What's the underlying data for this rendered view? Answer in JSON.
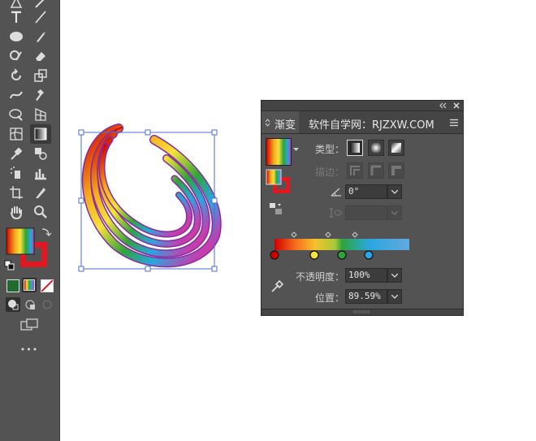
{
  "panel": {
    "tab_title": "渐变",
    "tab_watermark": "软件自学网：RJZXW.COM",
    "type_label": "类型：",
    "stroke_label": "描边：",
    "angle_value": "0°",
    "opacity_label": "不透明度：",
    "opacity_value": "100%",
    "location_label": "位置：",
    "location_value": "89.59%",
    "gradient_stops": [
      "#d10000",
      "#f5e33a",
      "#2fa43b",
      "#2aa6e0"
    ],
    "gradient_end_color": "#62a9de"
  },
  "toolbar": {
    "fill_colors": [
      "#d10000",
      "#f5e33a",
      "#2fa43b",
      "#2aa6e0",
      "#c23fb0"
    ],
    "stroke_color": "#e0181f",
    "more_label": "•••"
  }
}
